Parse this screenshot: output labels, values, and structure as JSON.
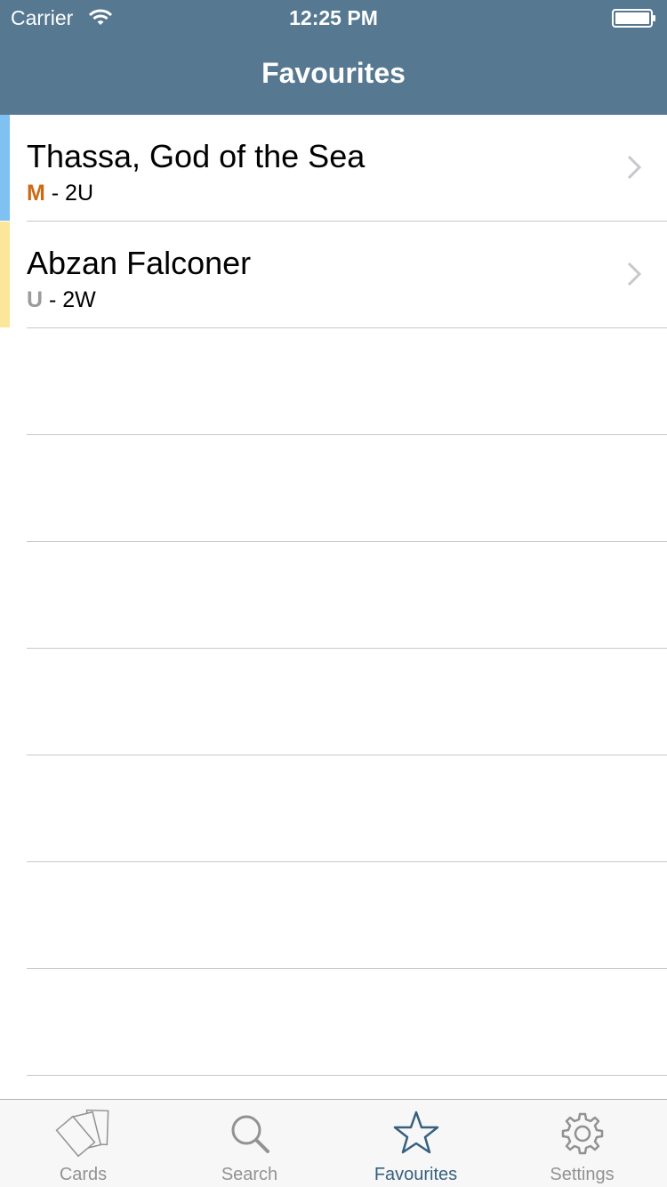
{
  "status_bar": {
    "carrier": "Carrier",
    "time": "12:25 PM"
  },
  "nav": {
    "title": "Favourites"
  },
  "colors": {
    "bar": "#567891",
    "active_tab": "#36607f",
    "inactive_tab": "#929292",
    "mythic": "#cc6a14",
    "uncommon": "#9b9b9b",
    "blue_strip": "#7fc1f1",
    "white_strip": "#fbe69a"
  },
  "cards": [
    {
      "name": "Thassa, God of the Sea",
      "rarity": "M",
      "separator": " - ",
      "cost": "2U",
      "rarity_color": "#cc6a14",
      "strip_color": "#7fc1f1"
    },
    {
      "name": "Abzan Falconer",
      "rarity": "U",
      "separator": " - ",
      "cost": "2W",
      "rarity_color": "#9b9b9b",
      "strip_color": "#fbe69a"
    }
  ],
  "tabs": [
    {
      "label": "Cards",
      "icon": "cards-icon",
      "active": false
    },
    {
      "label": "Search",
      "icon": "search-icon",
      "active": false
    },
    {
      "label": "Favourites",
      "icon": "star-icon",
      "active": true
    },
    {
      "label": "Settings",
      "icon": "gear-icon",
      "active": false
    }
  ]
}
